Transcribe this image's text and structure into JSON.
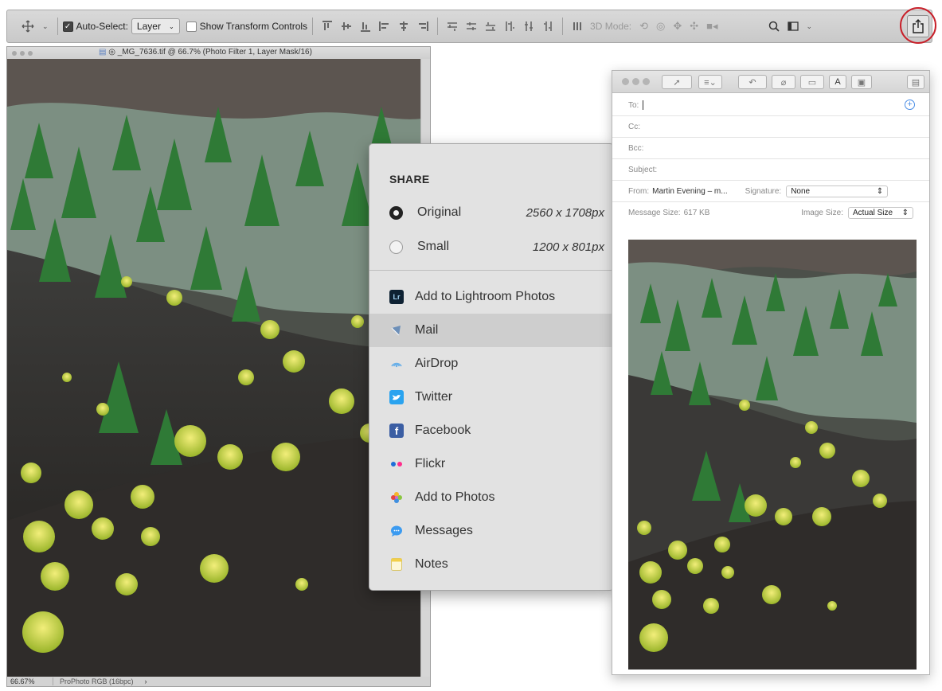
{
  "options_bar": {
    "auto_select_label": "Auto-Select:",
    "auto_select_checked": true,
    "layer_select_value": "Layer",
    "show_transform_label": "Show Transform Controls",
    "show_transform_checked": false,
    "mode_3d_label": "3D Mode:"
  },
  "document": {
    "title": "_MG_7636.tif @ 66.7% (Photo Filter 1, Layer Mask/16)",
    "zoom": "66.67%",
    "color_profile": "ProPhoto RGB (16bpc)"
  },
  "share_panel": {
    "heading": "SHARE",
    "sizes": [
      {
        "label": "Original",
        "dims": "2560 x 1708px",
        "selected": true
      },
      {
        "label": "Small",
        "dims": "1200 x 801px",
        "selected": false
      }
    ],
    "services": [
      {
        "label": "Add to Lightroom Photos",
        "icon": "lightroom-icon"
      },
      {
        "label": "Mail",
        "icon": "mail-icon",
        "highlighted": true
      },
      {
        "label": "AirDrop",
        "icon": "airdrop-icon"
      },
      {
        "label": "Twitter",
        "icon": "twitter-icon"
      },
      {
        "label": "Facebook",
        "icon": "facebook-icon"
      },
      {
        "label": "Flickr",
        "icon": "flickr-icon"
      },
      {
        "label": "Add to Photos",
        "icon": "photos-icon"
      },
      {
        "label": "Messages",
        "icon": "messages-icon"
      },
      {
        "label": "Notes",
        "icon": "notes-icon"
      }
    ]
  },
  "mail": {
    "to_label": "To:",
    "cc_label": "Cc:",
    "bcc_label": "Bcc:",
    "subject_label": "Subject:",
    "from_label": "From:",
    "from_value": "Martin Evening – m...",
    "signature_label": "Signature:",
    "signature_value": "None",
    "message_size_label": "Message Size:",
    "message_size_value": "617 KB",
    "image_size_label": "Image Size:",
    "image_size_value": "Actual Size"
  },
  "colors": {
    "highlight_circle": "#c8202a",
    "toolbar_bg": "#d2d2d2",
    "menu_bg": "#e2e2e2"
  }
}
